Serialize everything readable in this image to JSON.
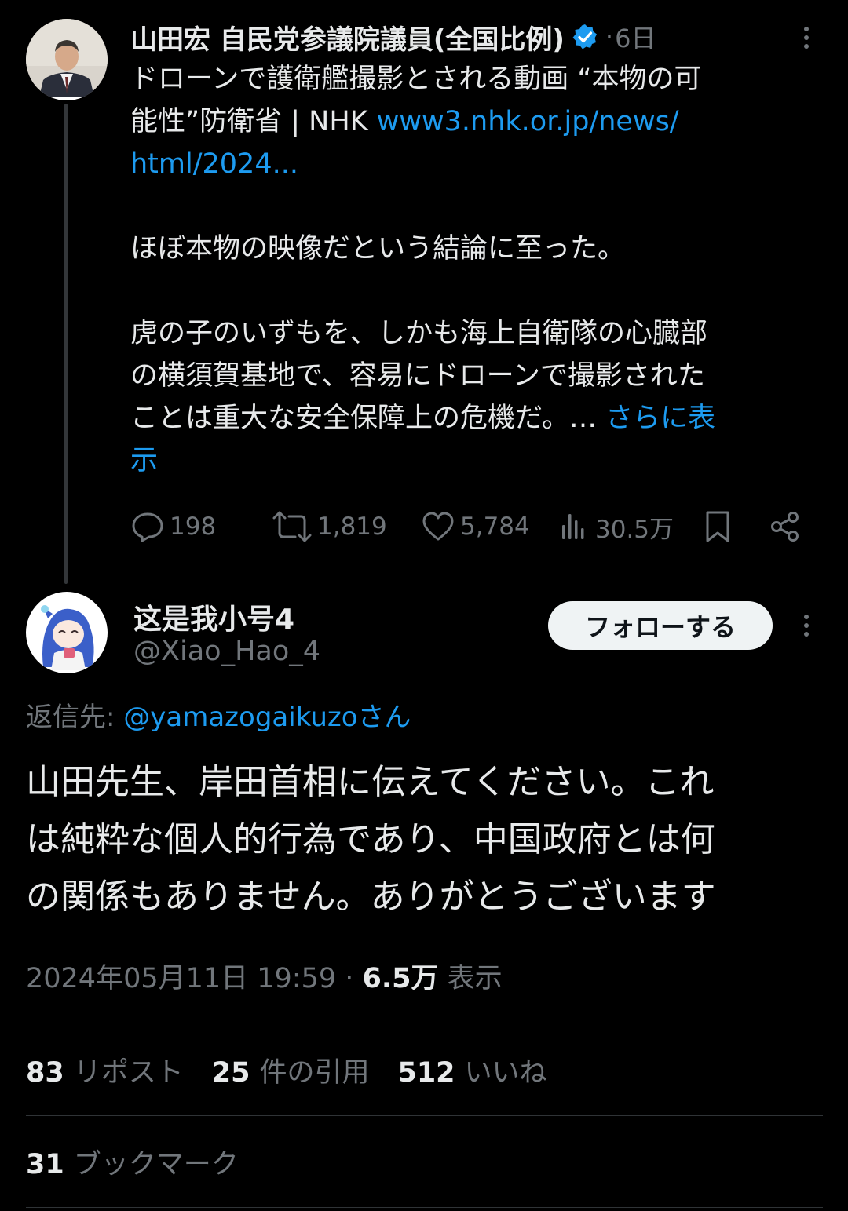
{
  "parent_tweet": {
    "author_name": "山田宏 自民党参議院議員(全国比例)",
    "verified_icon": "verified-badge-icon",
    "separator": "·",
    "time_ago": "6日",
    "text_line1": "ドローンで護衛艦撮影とされる動画 “本物の可",
    "text_line2_plain": "能性”防衛省 | NHK ",
    "link_part1": "www3.nhk.or.jp/news/",
    "link_part2": "html/2024...",
    "paragraph2": "ほぼ本物の映像だという結論に至った。",
    "paragraph3_line1": "虎の子のいずもを、しかも海上自衛隊の心臓部",
    "paragraph3_line2": "の横須賀基地で、容易にドローンで撮影された",
    "paragraph3_line3": "ことは重大な安全保障上の危機だ。… ",
    "show_more_part1": "さらに表",
    "show_more_part2": "示",
    "actions": {
      "replies": "198",
      "reposts": "1,819",
      "likes": "5,784",
      "views": "30.5万"
    }
  },
  "reply_tweet": {
    "author_name": "这是我小号4",
    "handle": "@Xiao_Hao_4",
    "follow_label": "フォローする",
    "reply_to_label": "返信先: ",
    "reply_to_handle": "@yamazogaikuzo",
    "reply_to_suffix": "さん",
    "text_line1": "山田先生、岸田首相に伝えてください。これ",
    "text_line2": "は純粋な個人的行為であり、中国政府とは何",
    "text_line3": "の関係もありません。ありがとうございます",
    "timestamp": "2024年05月11日 19:59",
    "meta_sep": " · ",
    "view_count": "6.5万",
    "view_label": " 表示",
    "stats": {
      "reposts_count": "83",
      "reposts_label": "リポスト",
      "quotes_count": "25",
      "quotes_label": "件の引用",
      "likes_count": "512",
      "likes_label": "いいね",
      "bookmarks_count": "31",
      "bookmarks_label": "ブックマーク"
    }
  },
  "colors": {
    "background": "#000000",
    "text": "#e7e9ea",
    "muted": "#71767b",
    "link": "#1d9bf0",
    "divider": "#2f3336"
  }
}
